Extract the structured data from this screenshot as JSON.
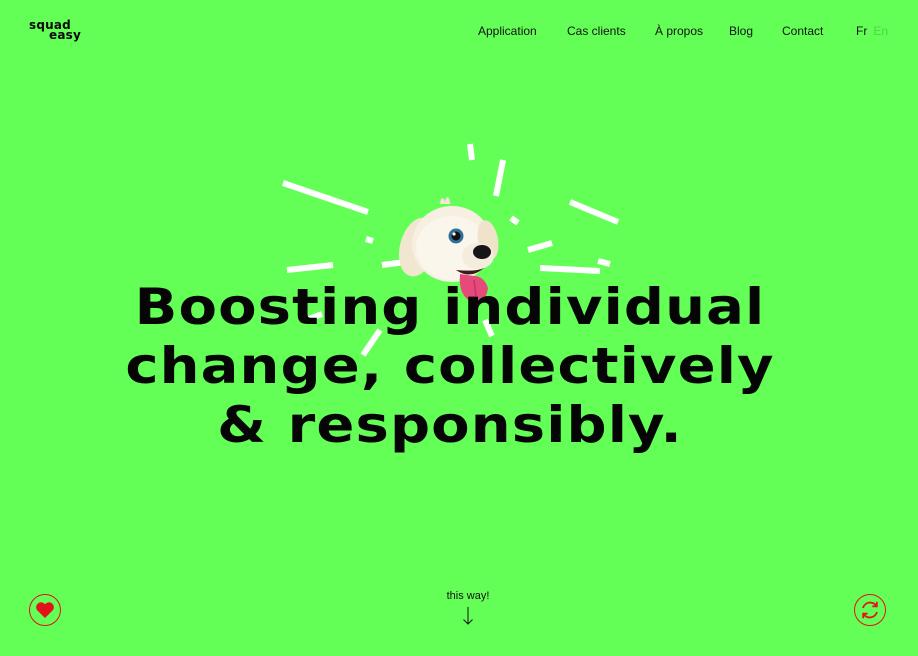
{
  "brand": {
    "line1": "squad",
    "line2": "easy"
  },
  "nav": {
    "items": [
      {
        "label": "Application"
      },
      {
        "label": "Cas clients"
      },
      {
        "label": "À propos"
      },
      {
        "label": "Blog"
      },
      {
        "label": "Contact"
      }
    ]
  },
  "language": {
    "active": "Fr",
    "inactive": "En"
  },
  "hero": {
    "line1": "Boosting individual",
    "line2": "change, collectively",
    "line3": "& responsibly."
  },
  "scroll_cue": {
    "label": "this way!"
  },
  "colors": {
    "background": "#63ff57",
    "text": "#0a0a0a",
    "accent": "#e4111a",
    "burst": "#ffffff"
  },
  "icons": {
    "left_button": "heart-icon",
    "right_button": "refresh-icon",
    "scroll": "arrow-down-icon"
  }
}
